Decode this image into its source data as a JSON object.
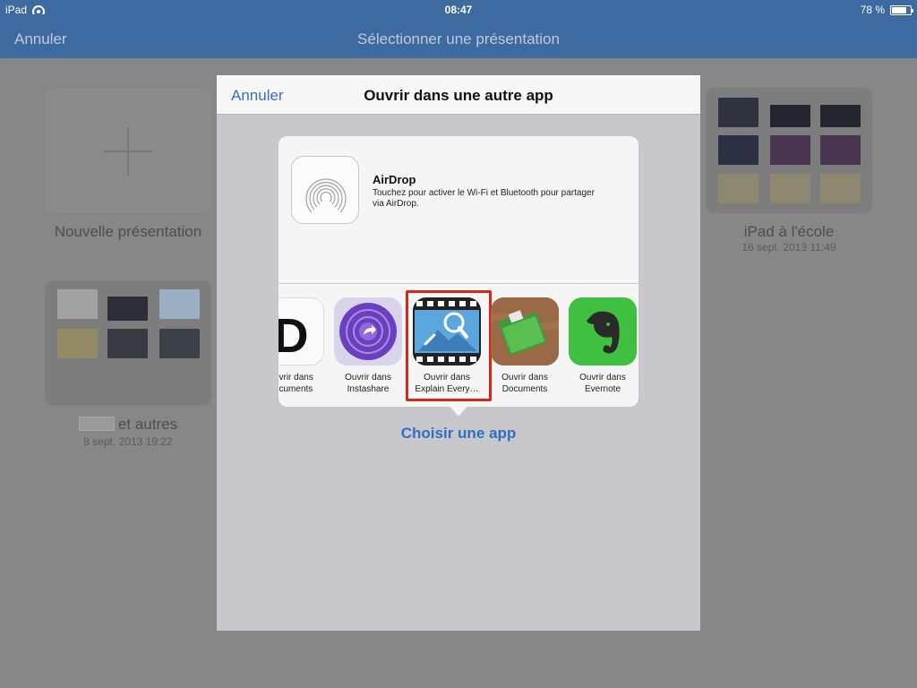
{
  "statusbar": {
    "device": "iPad",
    "time": "08:47",
    "battery": "78 %",
    "battery_level": 0.78
  },
  "navbar": {
    "cancel": "Annuler",
    "title": "Sélectionner une présentation"
  },
  "presentations": {
    "new": {
      "label": "Nouvelle présentation"
    },
    "group1": {
      "name_suffix": "et autres",
      "date": "8 sept. 2013 19:22"
    },
    "group2": {
      "name": "iPad à l'école",
      "date": "16 sept. 2013 11:49"
    }
  },
  "sheet": {
    "cancel": "Annuler",
    "title": "Ouvrir dans une autre app",
    "airdrop": {
      "name": "AirDrop",
      "description": "Touchez pour activer le Wi-Fi et Bluetooth pour partager via AirDrop."
    },
    "apps": [
      {
        "line1": "Ouvrir dans",
        "line2": "Documents",
        "icon": "documents-d-icon"
      },
      {
        "line1": "Ouvrir dans",
        "line2": "Instashare",
        "icon": "instashare-icon"
      },
      {
        "line1": "Ouvrir dans",
        "line2": "Explain Every…",
        "icon": "explain-everything-icon"
      },
      {
        "line1": "Ouvrir dans",
        "line2": "Documents",
        "icon": "documents-folder-icon"
      },
      {
        "line1": "Ouvrir dans",
        "line2": "Evernote",
        "icon": "evernote-icon"
      }
    ],
    "choose_app": "Choisir une app"
  }
}
